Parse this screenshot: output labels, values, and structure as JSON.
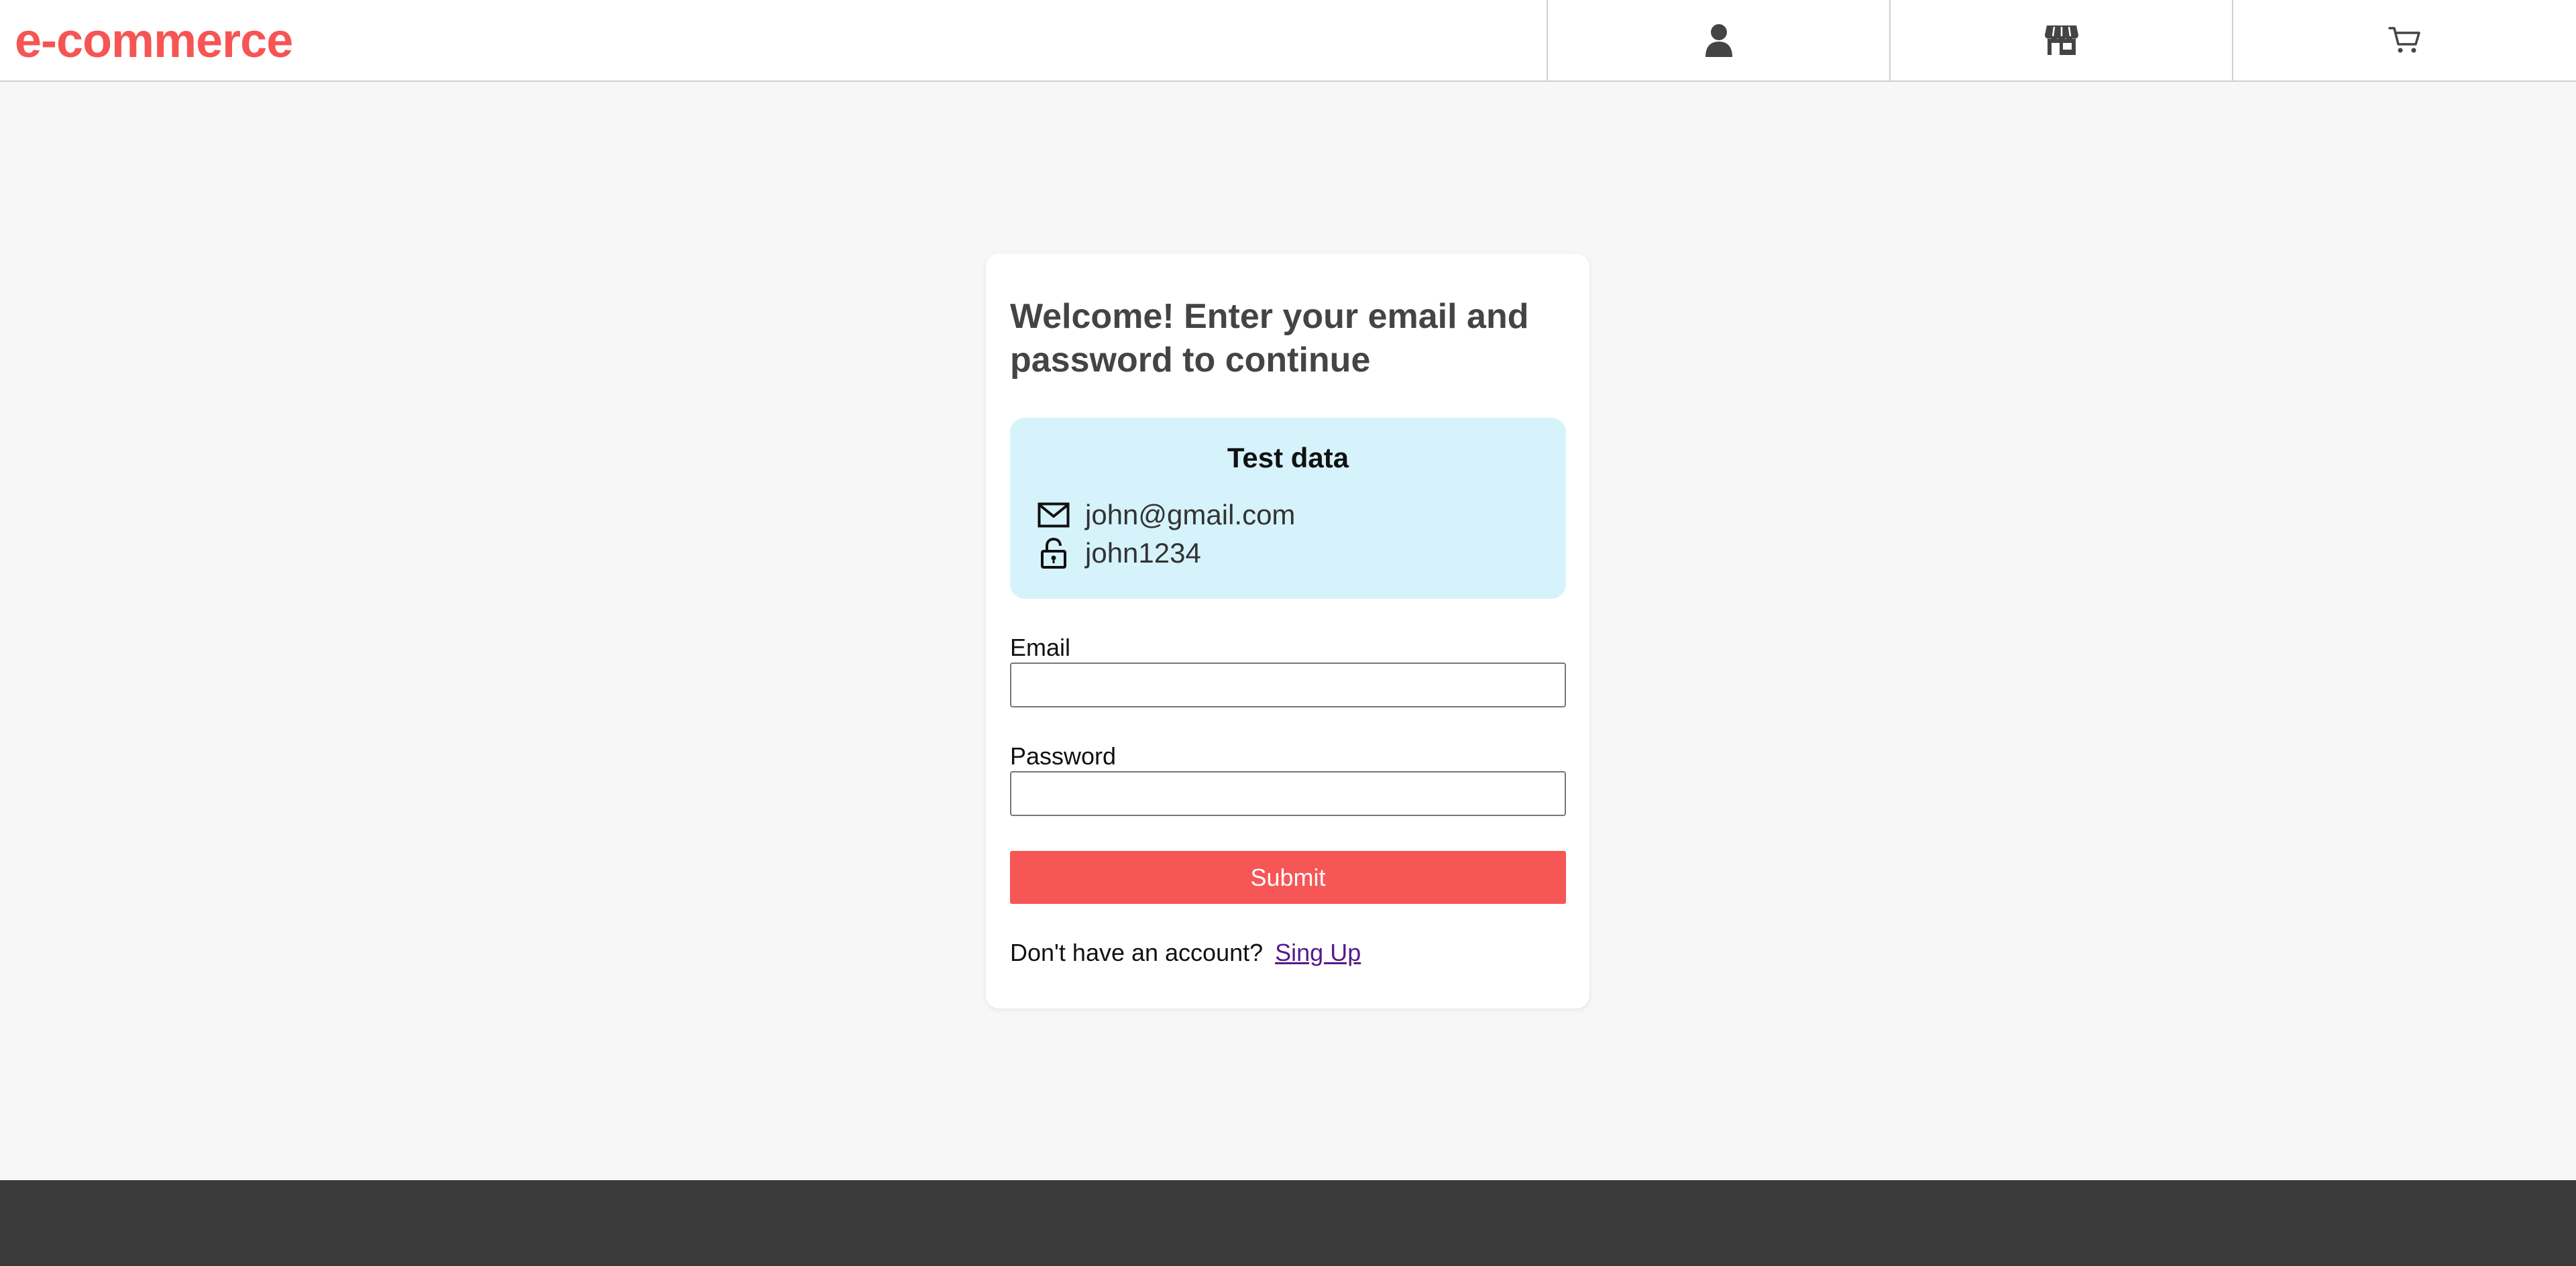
{
  "header": {
    "logo": "e-commerce",
    "nav": [
      {
        "icon": "user-icon"
      },
      {
        "icon": "store-icon"
      },
      {
        "icon": "cart-icon"
      }
    ]
  },
  "login": {
    "title": "Welcome! Enter your email and password to continue",
    "test_data": {
      "title": "Test data",
      "email": "john@gmail.com",
      "email_icon": "envelope-icon",
      "password": "john1234",
      "password_icon": "lock-icon"
    },
    "email_label": "Email",
    "email_value": "",
    "password_label": "Password",
    "password_value": "",
    "submit_label": "Submit",
    "signup_prompt": "Don't have an account?",
    "signup_link": "Sing Up"
  },
  "colors": {
    "brand": "#f75454",
    "test_box": "#d6f3fb",
    "footer": "#3b3b3b",
    "background": "#f7f7f7"
  }
}
